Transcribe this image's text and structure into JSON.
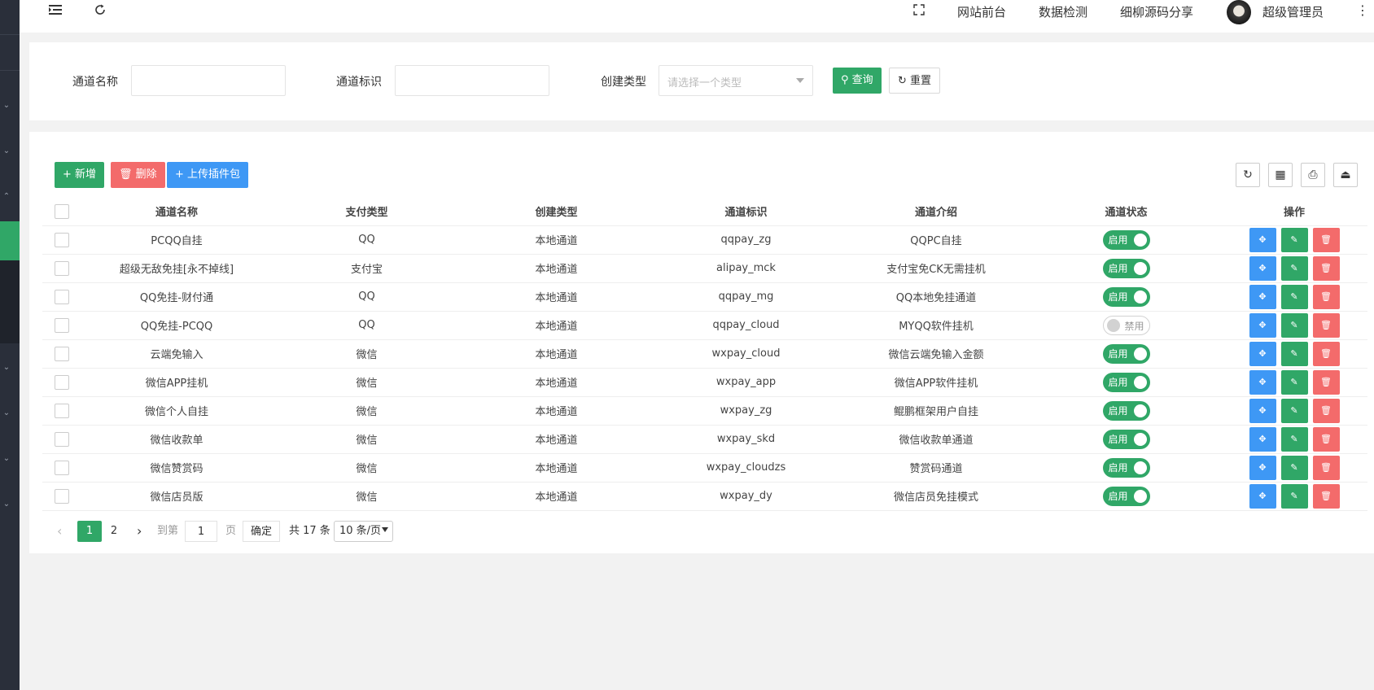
{
  "header": {
    "links": [
      "网站前台",
      "数据检测",
      "细柳源码分享"
    ],
    "user_name": "超级管理员"
  },
  "search": {
    "name_label": "通道名称",
    "name_value": "",
    "code_label": "通道标识",
    "code_value": "",
    "type_label": "创建类型",
    "type_placeholder": "请选择一个类型",
    "query_label": "查询",
    "reset_label": "重置"
  },
  "toolbar": {
    "add_label": "新增",
    "delete_label": "删除",
    "upload_label": "上传插件包"
  },
  "table": {
    "columns": [
      "通道名称",
      "支付类型",
      "创建类型",
      "通道标识",
      "通道介绍",
      "通道状态",
      "操作"
    ],
    "rows": [
      {
        "name": "PCQQ自挂",
        "pay_type": "QQ",
        "create_type": "本地通道",
        "code": "qqpay_zg",
        "intro": "QQPC自挂",
        "status": "启用",
        "enabled": true
      },
      {
        "name": "超级无敌免挂[永不掉线]",
        "pay_type": "支付宝",
        "create_type": "本地通道",
        "code": "alipay_mck",
        "intro": "支付宝免CK无需挂机",
        "status": "启用",
        "enabled": true
      },
      {
        "name": "QQ免挂-财付通",
        "pay_type": "QQ",
        "create_type": "本地通道",
        "code": "qqpay_mg",
        "intro": "QQ本地免挂通道",
        "status": "启用",
        "enabled": true
      },
      {
        "name": "QQ免挂-PCQQ",
        "pay_type": "QQ",
        "create_type": "本地通道",
        "code": "qqpay_cloud",
        "intro": "MYQQ软件挂机",
        "status": "禁用",
        "enabled": false
      },
      {
        "name": "云端免输入",
        "pay_type": "微信",
        "create_type": "本地通道",
        "code": "wxpay_cloud",
        "intro": "微信云端免输入金额",
        "status": "启用",
        "enabled": true
      },
      {
        "name": "微信APP挂机",
        "pay_type": "微信",
        "create_type": "本地通道",
        "code": "wxpay_app",
        "intro": "微信APP软件挂机",
        "status": "启用",
        "enabled": true
      },
      {
        "name": "微信个人自挂",
        "pay_type": "微信",
        "create_type": "本地通道",
        "code": "wxpay_zg",
        "intro": "鲲鹏框架用户自挂",
        "status": "启用",
        "enabled": true
      },
      {
        "name": "微信收款单",
        "pay_type": "微信",
        "create_type": "本地通道",
        "code": "wxpay_skd",
        "intro": "微信收款单通道",
        "status": "启用",
        "enabled": true
      },
      {
        "name": "微信赞赏码",
        "pay_type": "微信",
        "create_type": "本地通道",
        "code": "wxpay_cloudzs",
        "intro": "赞赏码通道",
        "status": "启用",
        "enabled": true
      },
      {
        "name": "微信店员版",
        "pay_type": "微信",
        "create_type": "本地通道",
        "code": "wxpay_dy",
        "intro": "微信店员免挂模式",
        "status": "启用",
        "enabled": true
      }
    ]
  },
  "pager": {
    "current": "1",
    "next_page": "2",
    "goto_label": "到第",
    "goto_value": "1",
    "page_unit": "页",
    "confirm_label": "确定",
    "total_text": "共 17 条",
    "page_size": "10 条/页"
  },
  "colors": {
    "primary": "#30a767",
    "danger": "#f36b6b",
    "info": "#3e98f5",
    "qq": "#f05a27",
    "alipay": "#1a8ad6"
  }
}
